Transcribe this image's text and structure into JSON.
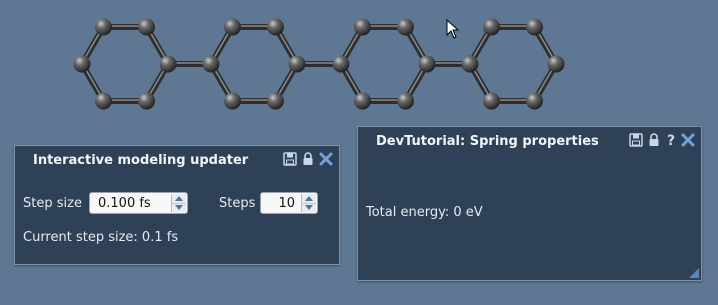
{
  "updater_panel": {
    "title": "Interactive modeling updater",
    "step_size_label": "Step size",
    "step_size_value": "0.100 fs",
    "steps_label": "Steps",
    "steps_value": "10",
    "current_step_text": "Current step size: 0.1 fs"
  },
  "spring_panel": {
    "title": "DevTutorial: Spring properties",
    "total_energy_text": "Total energy: 0 eV"
  },
  "titlebar_icons": [
    "save-icon",
    "lock-icon",
    "help-icon",
    "close-icon"
  ],
  "colors": {
    "background": "#5e7893",
    "panel": "#2f4157",
    "atom": "#3a3a3a",
    "bond": "#505050",
    "close_icon": "#6fa3dc"
  },
  "molecule": {
    "name_hidden": true,
    "rings": 4
  }
}
